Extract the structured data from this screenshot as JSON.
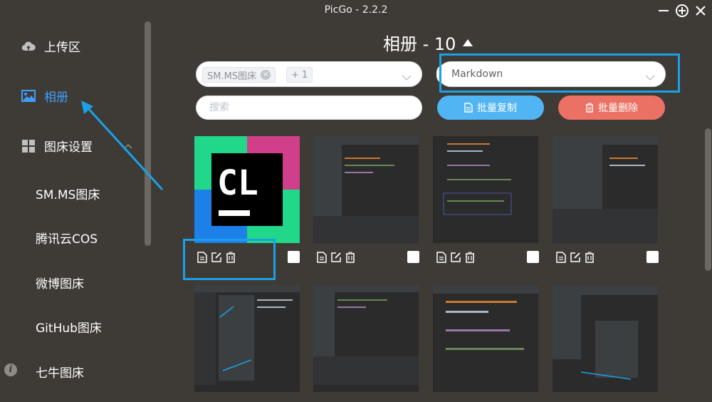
{
  "window": {
    "title": "PicGo - 2.2.2"
  },
  "sidebar": {
    "items": [
      {
        "label": "上传区",
        "icon": "cloud-upload-icon"
      },
      {
        "label": "相册",
        "icon": "image-icon",
        "active": true
      },
      {
        "label": "图床设置",
        "icon": "grid-icon"
      }
    ],
    "sub_items": [
      "SM.MS图床",
      "腾讯云COS",
      "微博图床",
      "GitHub图床",
      "七牛图床"
    ]
  },
  "gallery": {
    "title": "相册 - 10",
    "picbed_filter": {
      "tag": "SM.MS图床",
      "extra": "+ 1"
    },
    "link_format": "Markdown",
    "search_placeholder": "搜索",
    "copy_label": "批量复制",
    "delete_label": "批量删除",
    "thumbnails_visible": 8,
    "thumbnail_icons": [
      "file-copy-icon",
      "edit-icon",
      "trash-icon"
    ]
  },
  "colors": {
    "background": "#3e3a35",
    "accent": "#409eff",
    "copy_button": "#51b5f3",
    "delete_button": "#ea7163",
    "highlight": "#1aa1e6"
  }
}
